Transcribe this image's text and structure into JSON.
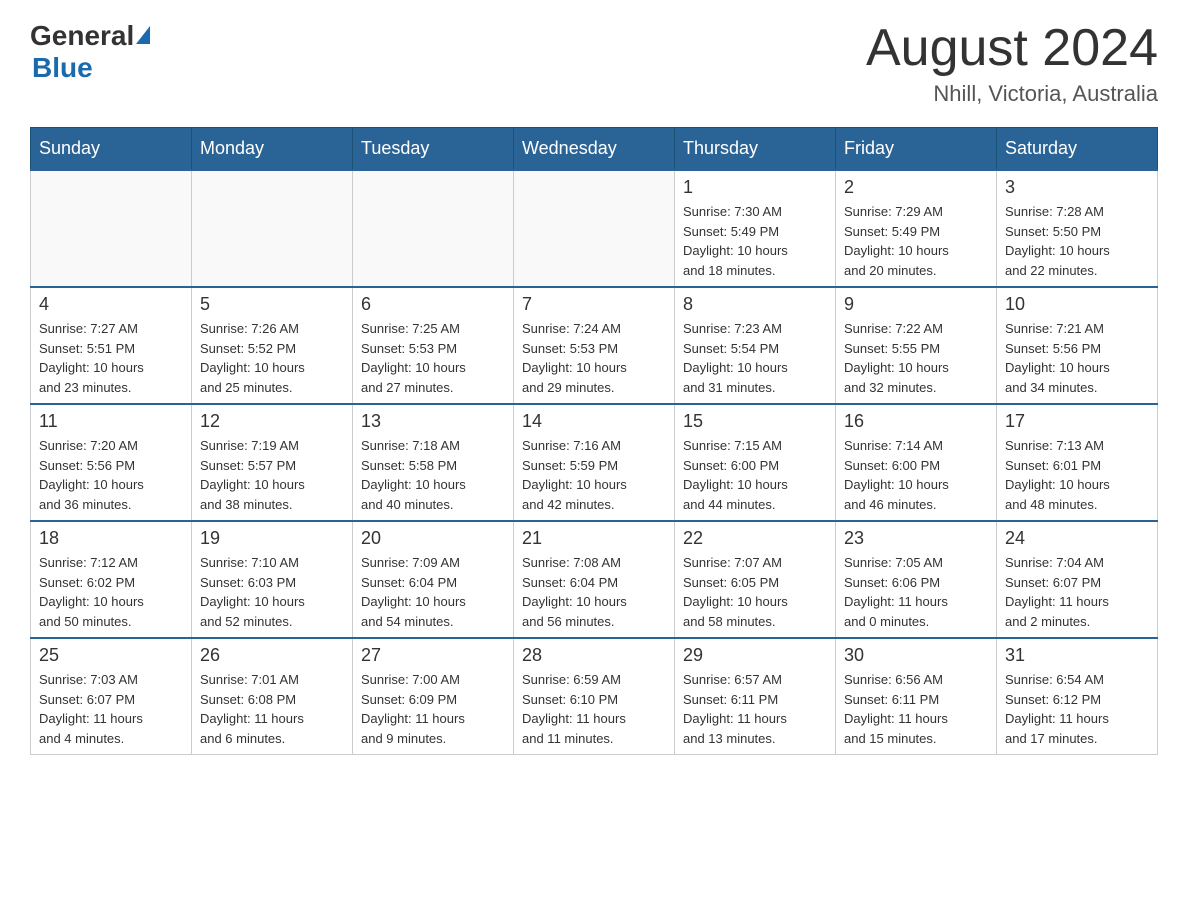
{
  "header": {
    "logo_general": "General",
    "logo_blue": "Blue",
    "month_title": "August 2024",
    "location": "Nhill, Victoria, Australia"
  },
  "days_of_week": [
    "Sunday",
    "Monday",
    "Tuesday",
    "Wednesday",
    "Thursday",
    "Friday",
    "Saturday"
  ],
  "weeks": [
    {
      "days": [
        {
          "number": "",
          "info": ""
        },
        {
          "number": "",
          "info": ""
        },
        {
          "number": "",
          "info": ""
        },
        {
          "number": "",
          "info": ""
        },
        {
          "number": "1",
          "info": "Sunrise: 7:30 AM\nSunset: 5:49 PM\nDaylight: 10 hours\nand 18 minutes."
        },
        {
          "number": "2",
          "info": "Sunrise: 7:29 AM\nSunset: 5:49 PM\nDaylight: 10 hours\nand 20 minutes."
        },
        {
          "number": "3",
          "info": "Sunrise: 7:28 AM\nSunset: 5:50 PM\nDaylight: 10 hours\nand 22 minutes."
        }
      ]
    },
    {
      "days": [
        {
          "number": "4",
          "info": "Sunrise: 7:27 AM\nSunset: 5:51 PM\nDaylight: 10 hours\nand 23 minutes."
        },
        {
          "number": "5",
          "info": "Sunrise: 7:26 AM\nSunset: 5:52 PM\nDaylight: 10 hours\nand 25 minutes."
        },
        {
          "number": "6",
          "info": "Sunrise: 7:25 AM\nSunset: 5:53 PM\nDaylight: 10 hours\nand 27 minutes."
        },
        {
          "number": "7",
          "info": "Sunrise: 7:24 AM\nSunset: 5:53 PM\nDaylight: 10 hours\nand 29 minutes."
        },
        {
          "number": "8",
          "info": "Sunrise: 7:23 AM\nSunset: 5:54 PM\nDaylight: 10 hours\nand 31 minutes."
        },
        {
          "number": "9",
          "info": "Sunrise: 7:22 AM\nSunset: 5:55 PM\nDaylight: 10 hours\nand 32 minutes."
        },
        {
          "number": "10",
          "info": "Sunrise: 7:21 AM\nSunset: 5:56 PM\nDaylight: 10 hours\nand 34 minutes."
        }
      ]
    },
    {
      "days": [
        {
          "number": "11",
          "info": "Sunrise: 7:20 AM\nSunset: 5:56 PM\nDaylight: 10 hours\nand 36 minutes."
        },
        {
          "number": "12",
          "info": "Sunrise: 7:19 AM\nSunset: 5:57 PM\nDaylight: 10 hours\nand 38 minutes."
        },
        {
          "number": "13",
          "info": "Sunrise: 7:18 AM\nSunset: 5:58 PM\nDaylight: 10 hours\nand 40 minutes."
        },
        {
          "number": "14",
          "info": "Sunrise: 7:16 AM\nSunset: 5:59 PM\nDaylight: 10 hours\nand 42 minutes."
        },
        {
          "number": "15",
          "info": "Sunrise: 7:15 AM\nSunset: 6:00 PM\nDaylight: 10 hours\nand 44 minutes."
        },
        {
          "number": "16",
          "info": "Sunrise: 7:14 AM\nSunset: 6:00 PM\nDaylight: 10 hours\nand 46 minutes."
        },
        {
          "number": "17",
          "info": "Sunrise: 7:13 AM\nSunset: 6:01 PM\nDaylight: 10 hours\nand 48 minutes."
        }
      ]
    },
    {
      "days": [
        {
          "number": "18",
          "info": "Sunrise: 7:12 AM\nSunset: 6:02 PM\nDaylight: 10 hours\nand 50 minutes."
        },
        {
          "number": "19",
          "info": "Sunrise: 7:10 AM\nSunset: 6:03 PM\nDaylight: 10 hours\nand 52 minutes."
        },
        {
          "number": "20",
          "info": "Sunrise: 7:09 AM\nSunset: 6:04 PM\nDaylight: 10 hours\nand 54 minutes."
        },
        {
          "number": "21",
          "info": "Sunrise: 7:08 AM\nSunset: 6:04 PM\nDaylight: 10 hours\nand 56 minutes."
        },
        {
          "number": "22",
          "info": "Sunrise: 7:07 AM\nSunset: 6:05 PM\nDaylight: 10 hours\nand 58 minutes."
        },
        {
          "number": "23",
          "info": "Sunrise: 7:05 AM\nSunset: 6:06 PM\nDaylight: 11 hours\nand 0 minutes."
        },
        {
          "number": "24",
          "info": "Sunrise: 7:04 AM\nSunset: 6:07 PM\nDaylight: 11 hours\nand 2 minutes."
        }
      ]
    },
    {
      "days": [
        {
          "number": "25",
          "info": "Sunrise: 7:03 AM\nSunset: 6:07 PM\nDaylight: 11 hours\nand 4 minutes."
        },
        {
          "number": "26",
          "info": "Sunrise: 7:01 AM\nSunset: 6:08 PM\nDaylight: 11 hours\nand 6 minutes."
        },
        {
          "number": "27",
          "info": "Sunrise: 7:00 AM\nSunset: 6:09 PM\nDaylight: 11 hours\nand 9 minutes."
        },
        {
          "number": "28",
          "info": "Sunrise: 6:59 AM\nSunset: 6:10 PM\nDaylight: 11 hours\nand 11 minutes."
        },
        {
          "number": "29",
          "info": "Sunrise: 6:57 AM\nSunset: 6:11 PM\nDaylight: 11 hours\nand 13 minutes."
        },
        {
          "number": "30",
          "info": "Sunrise: 6:56 AM\nSunset: 6:11 PM\nDaylight: 11 hours\nand 15 minutes."
        },
        {
          "number": "31",
          "info": "Sunrise: 6:54 AM\nSunset: 6:12 PM\nDaylight: 11 hours\nand 17 minutes."
        }
      ]
    }
  ]
}
